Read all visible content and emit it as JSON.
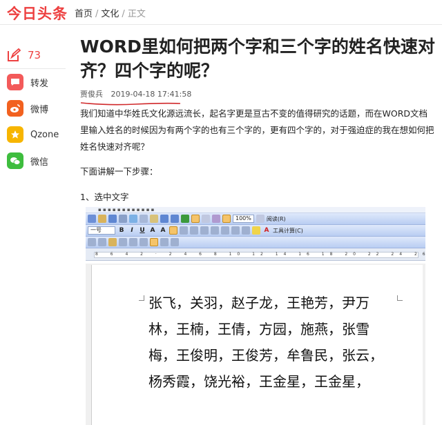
{
  "header": {
    "logo": "今日头条",
    "breadcrumb": [
      "首页",
      "文化",
      "正文"
    ],
    "sep": "/"
  },
  "rail": {
    "likes": "73",
    "share": [
      {
        "label": "转发",
        "icon": "comment-bubble-icon",
        "color": "#f35a5a"
      },
      {
        "label": "微博",
        "icon": "weibo-icon",
        "color": "#f2611f"
      },
      {
        "label": "Qzone",
        "icon": "qzone-star-icon",
        "color": "#f7b500"
      },
      {
        "label": "微信",
        "icon": "wechat-icon",
        "color": "#3ebd3e"
      }
    ]
  },
  "article": {
    "title": "WORD里如何把两个字和三个字的姓名快速对齐？四个字的呢？",
    "author": "贾俊兵",
    "date": "2019-04-18 17:41:58",
    "para1": "我们知道中华姓氏文化源远流长，起名字更是亘古不变的值得研究的话题，而在WORD文档里输入姓名的时候因为有两个字的也有三个字的，更有四个字的，对于强迫症的我在想如何把姓名快速对齐呢？",
    "para2": "下面讲解一下步骤：",
    "para3": "1、选中文字"
  },
  "word": {
    "zoom": "100%",
    "read_label": "阅读(R)",
    "font_size": "一号",
    "right_label": "工具计算(C)",
    "lines": [
      "张飞，关羽，赵子龙，王艳芳，尹万",
      "林，王楠，王倩，方园，施燕，张雪",
      "梅，王俊明，王俊芳，牟鲁民，张云，",
      "杨秀霞，饶光裕，王金星，王金星，"
    ]
  },
  "colors": {
    "brand_red": "#ed4040",
    "toolbar_blue": "#c7d7f5"
  }
}
